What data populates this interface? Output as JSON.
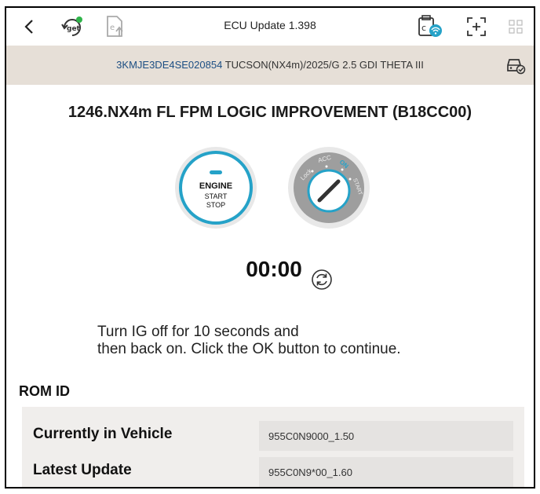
{
  "header": {
    "back_icon": "chevron-left-icon",
    "title": "ECU Update 1.398",
    "icons": [
      "software-update-icon",
      "export-file-icon",
      "vci-connection-icon",
      "screen-capture-icon",
      "grid-menu-icon"
    ]
  },
  "vehicle": {
    "vin": "3KMJE3DE4SE020854",
    "model": "TUCSON(NX4m)/2025/G 2.5 GDI THETA III",
    "icon": "vehicle-status-icon"
  },
  "update": {
    "title": "1246.NX4m FL FPM LOGIC IMPROVEMENT (B18CC00)",
    "engine_button": {
      "line1": "ENGINE",
      "line2": "START",
      "line3": "STOP"
    },
    "ignition": {
      "lock": "Lock",
      "acc": "ACC",
      "on": "ON",
      "start": "START"
    },
    "timer": "00:00",
    "instruction_line1": "Turn IG off for 10 seconds and",
    "instruction_line2": "then back on. Click the OK button to continue."
  },
  "rom": {
    "title": "ROM ID",
    "rows": [
      {
        "label": "Currently in Vehicle",
        "value": "955C0N9000_1.50"
      },
      {
        "label": "Latest Update",
        "value": "955C0N9*00_1.60"
      }
    ]
  },
  "colors": {
    "accent_teal": "#25a2c8",
    "vin_blue": "#1c4e83",
    "vehicle_bar": "#e6dfd7"
  }
}
